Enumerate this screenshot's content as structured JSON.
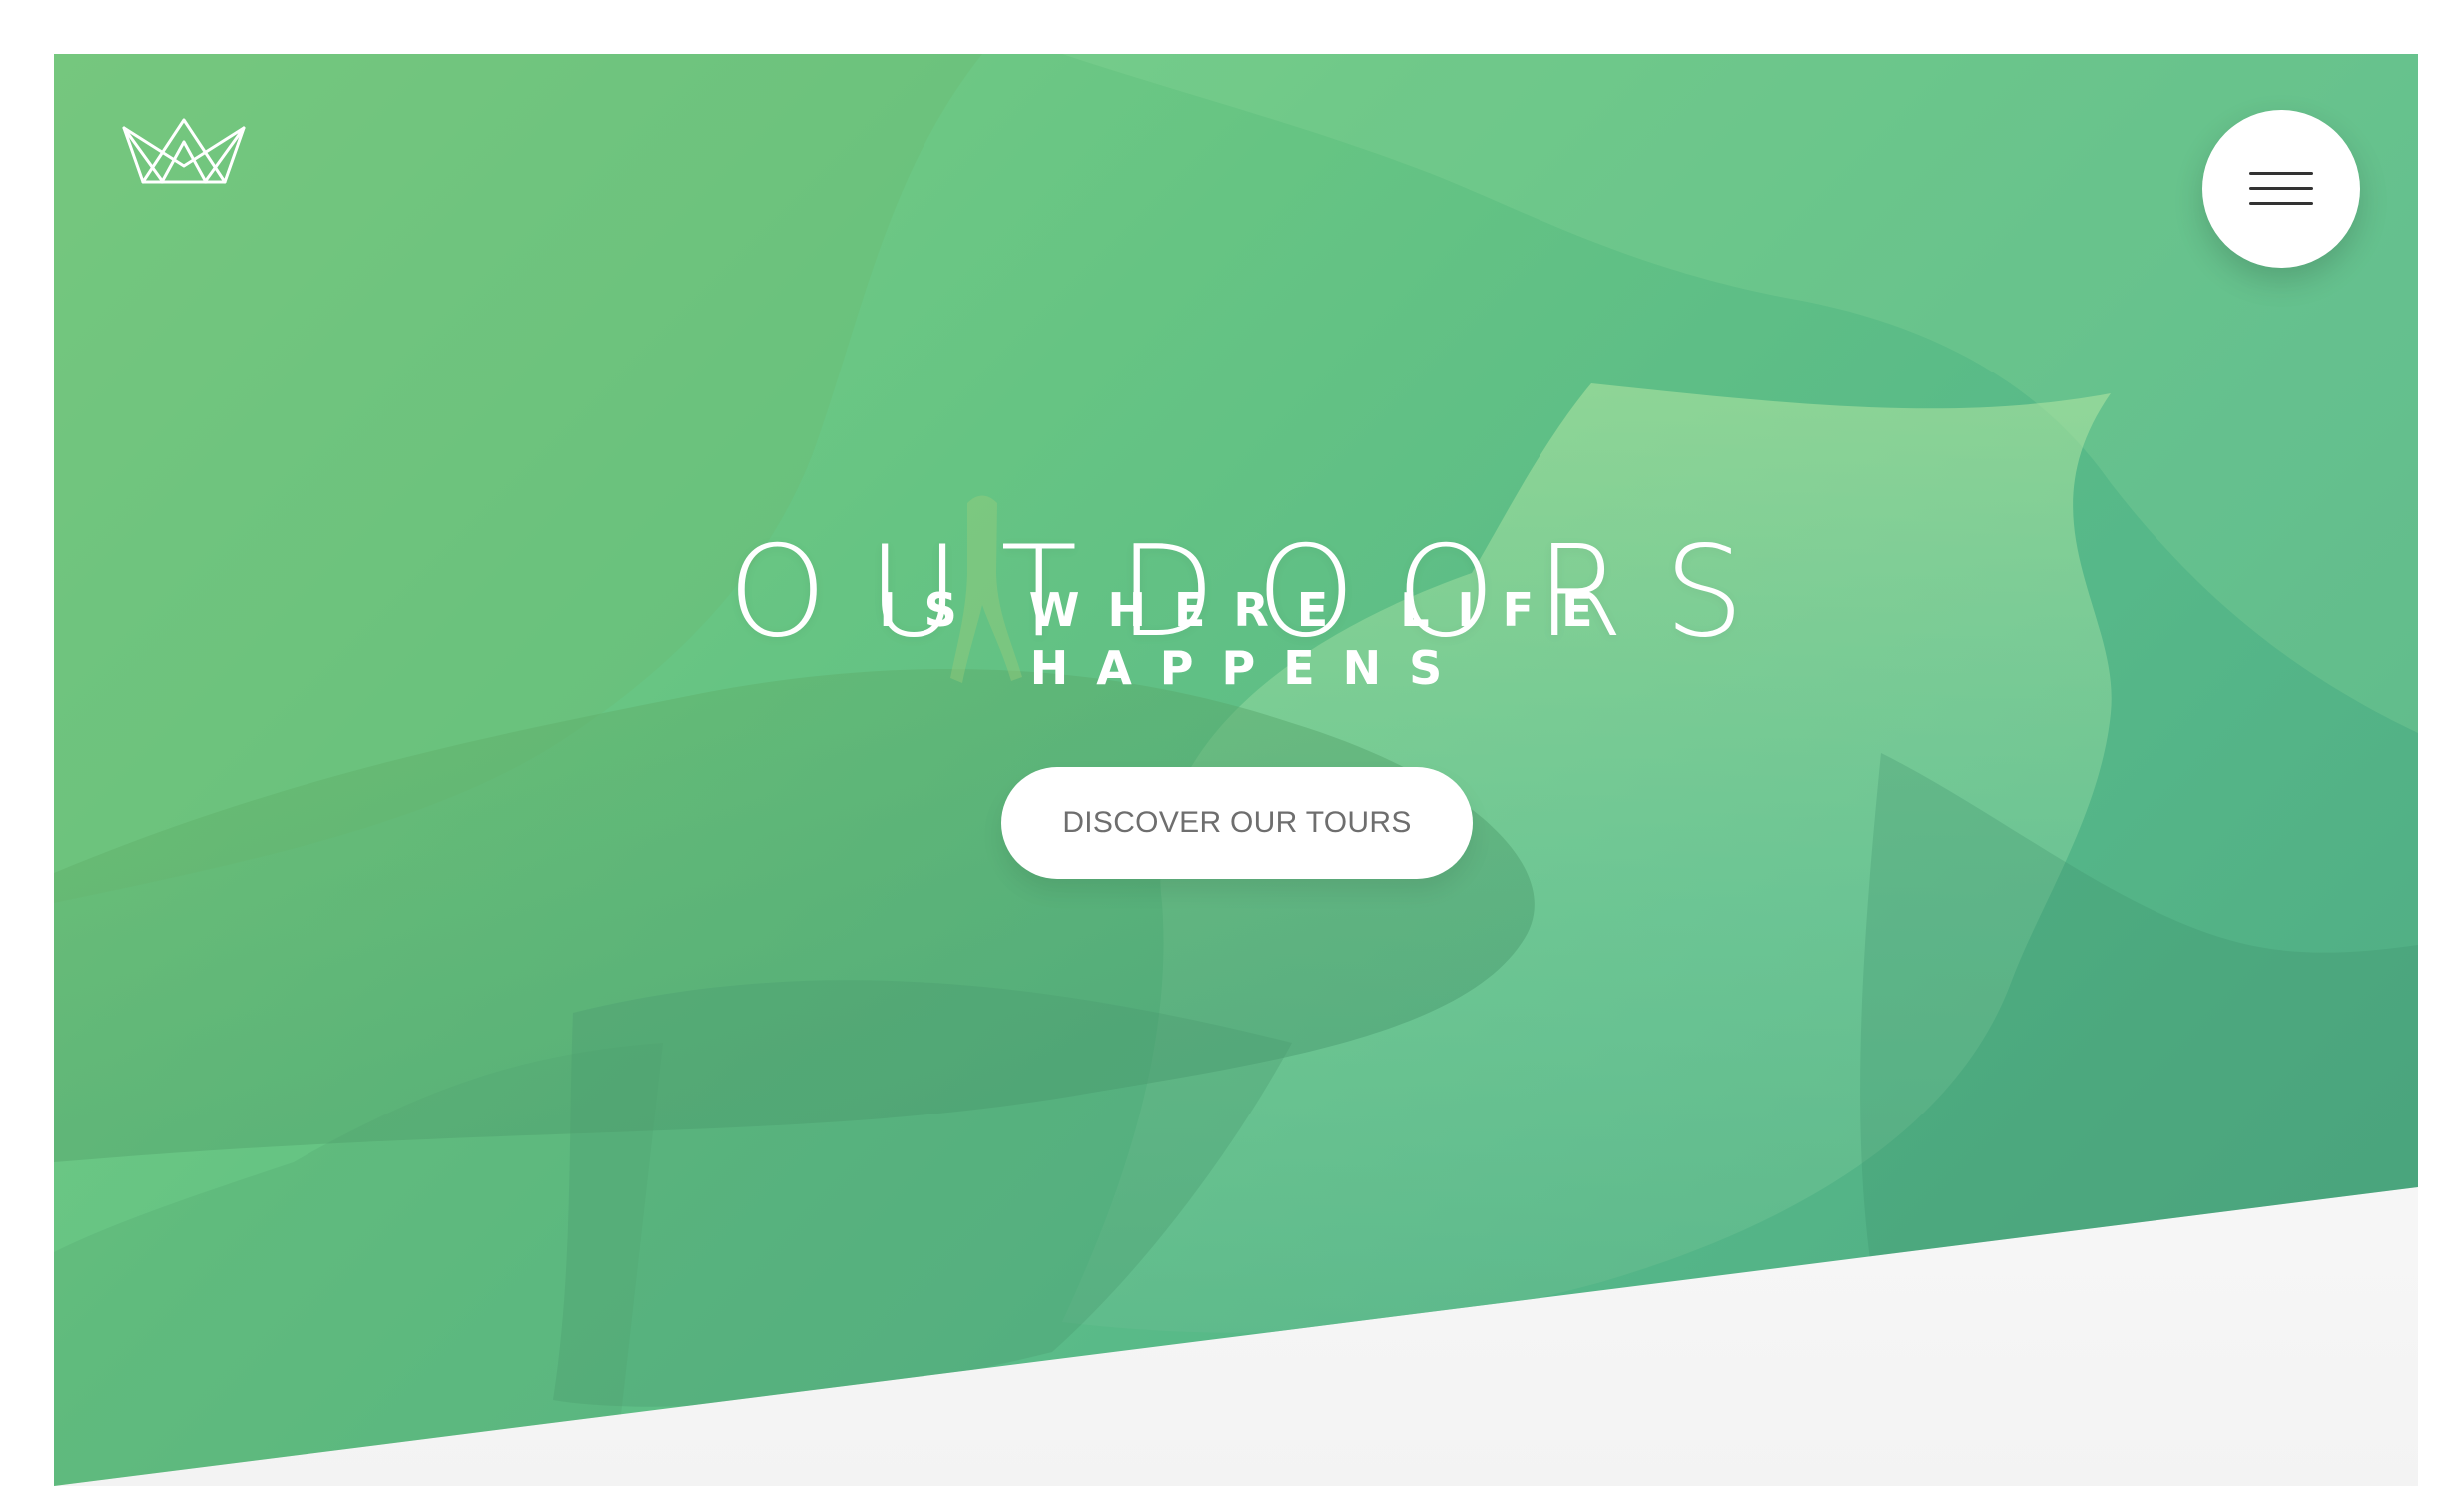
{
  "header": {
    "logo_icon": "crown-outline-icon",
    "menu_icon": "hamburger-menu-icon"
  },
  "hero": {
    "title": "OUTDOORS",
    "subtitle_line_1": "IS WHERE LIFE",
    "subtitle_line_2": "HAPPENS",
    "button_label": "DISCOVER OUR TOURS",
    "overlay_colors": [
      "#7dcf86",
      "#66c483",
      "#56b889",
      "#4ea982"
    ],
    "button_text_color": "#6e6e6e"
  }
}
